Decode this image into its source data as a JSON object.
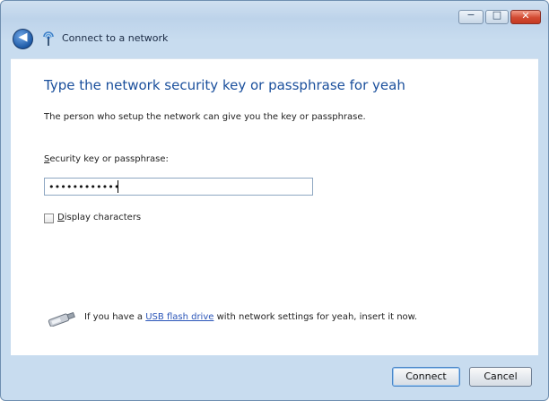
{
  "window": {
    "title": "Connect to a network",
    "controls": {
      "minimize_glyph": "−",
      "maximize_glyph": "□",
      "close_glyph": "✕"
    },
    "back_glyph": "◀"
  },
  "main": {
    "heading": "Type the network security key or passphrase for yeah",
    "description": "The person who setup the network can give you the key or passphrase.",
    "key_label_access": "S",
    "key_label_rest": "ecurity key or passphrase:",
    "key_value": "••••••••••••",
    "display_checkbox_checked": false,
    "display_label_access": "D",
    "display_label_rest": "isplay characters",
    "usb_prefix": "If you have a ",
    "usb_link": "USB flash drive",
    "usb_suffix": " with network settings for yeah, insert it now."
  },
  "footer": {
    "connect_label": "Connect",
    "cancel_label": "Cancel"
  }
}
